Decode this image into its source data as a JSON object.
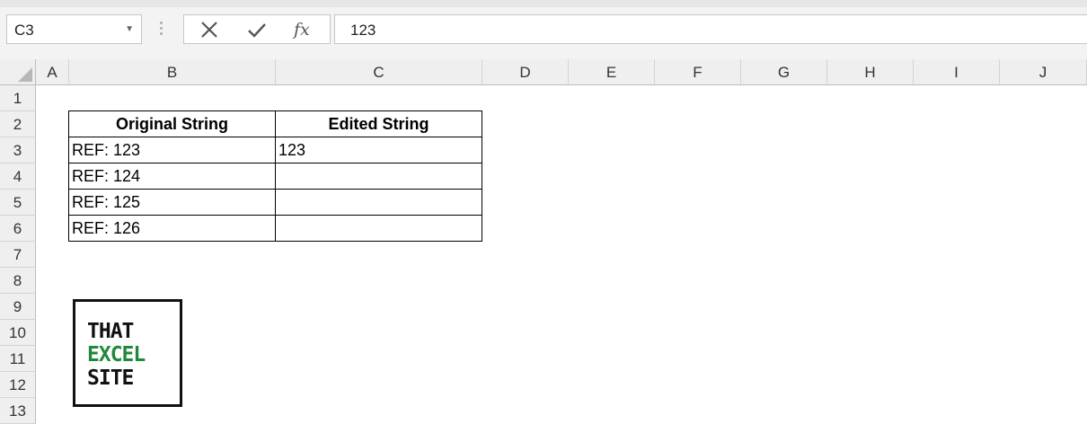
{
  "formula_bar": {
    "name_box": "C3",
    "cancel_icon": "close-icon",
    "enter_icon": "checkmark-icon",
    "function_label": "fx",
    "formula_value": "123"
  },
  "columns": [
    "A",
    "B",
    "C",
    "D",
    "E",
    "F",
    "G",
    "H",
    "I",
    "J"
  ],
  "rows": [
    "1",
    "2",
    "3",
    "4",
    "5",
    "6",
    "7",
    "8",
    "9",
    "10",
    "11",
    "12",
    "13"
  ],
  "table": {
    "headers": [
      "Original String",
      "Edited String"
    ],
    "rows": [
      [
        "REF: 123",
        "123"
      ],
      [
        "REF: 124",
        ""
      ],
      [
        "REF: 125",
        ""
      ],
      [
        "REF: 126",
        ""
      ]
    ]
  },
  "logo": {
    "line1": "THAT",
    "line2": "EXCEL",
    "line3": "SITE",
    "accent_color": "#1f8a3b"
  }
}
